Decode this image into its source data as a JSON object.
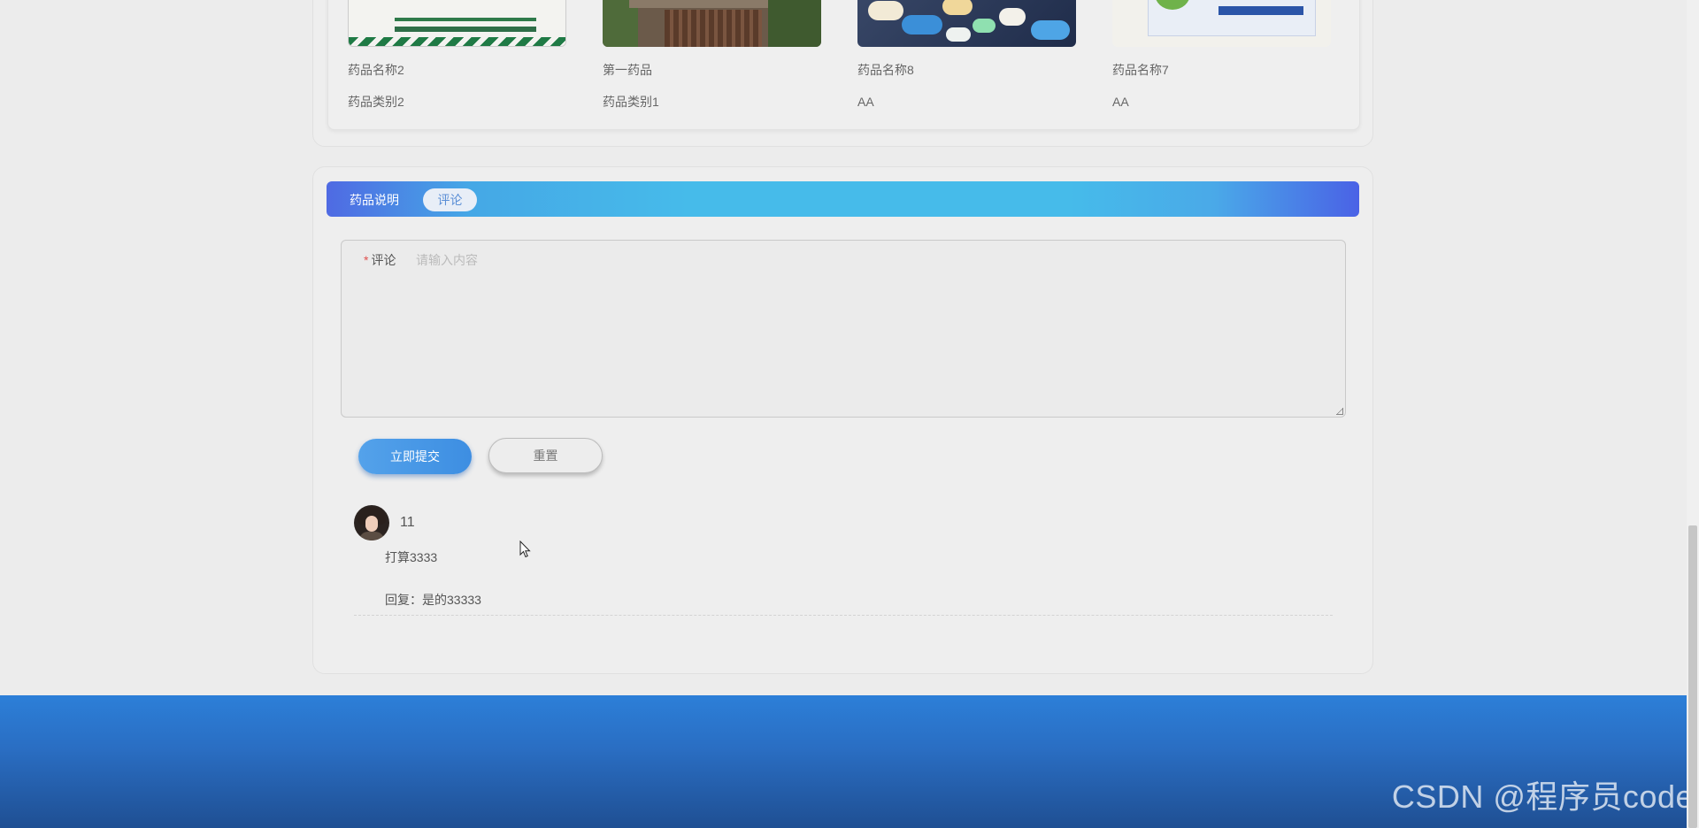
{
  "recommended": {
    "products": [
      {
        "name": "药品名称2",
        "category": "药品类别2",
        "thumb": "medicine-box-image"
      },
      {
        "name": "第一药品",
        "category": "药品类别1",
        "thumb": "building-image"
      },
      {
        "name": "药品名称8",
        "category": "AA",
        "thumb": "pills-image"
      },
      {
        "name": "药品名称7",
        "category": "AA",
        "thumb": "medicine-box-image"
      }
    ]
  },
  "tabs": {
    "description": "药品说明",
    "comment": "评论"
  },
  "comment_form": {
    "label": "评论",
    "required_mark": "*",
    "placeholder": "请输入内容",
    "submit_label": "立即提交",
    "reset_label": "重置"
  },
  "comments": [
    {
      "username": "11",
      "text": "打算3333",
      "reply": "回复：是的33333"
    }
  ],
  "footer": {
    "watermark": "CSDN @程序员code"
  },
  "colors": {
    "accent": "#46bbea",
    "button_primary": "#3d8ee2",
    "footer": "#2a6ec3"
  }
}
